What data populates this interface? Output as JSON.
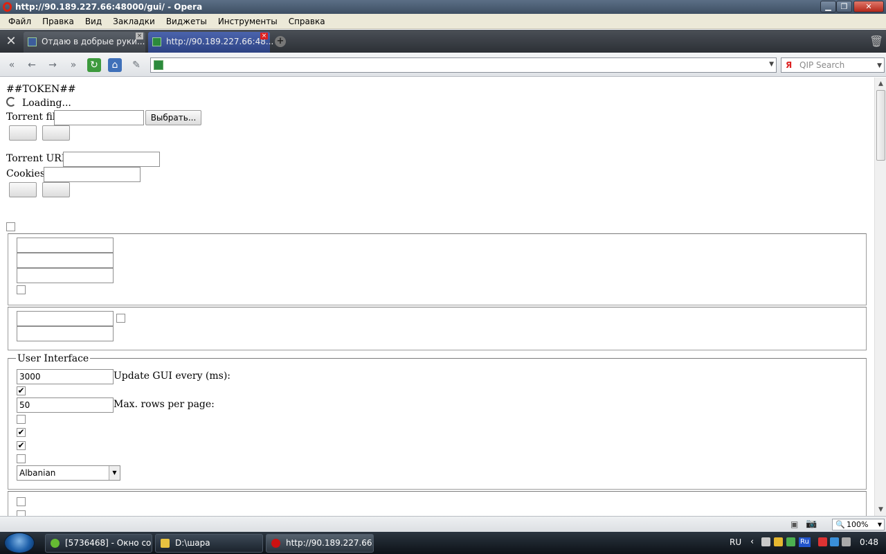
{
  "window": {
    "title": "http://90.189.227.66:48000/gui/ - Opera",
    "minimize": "▁",
    "maximize": "❐",
    "close": "✕"
  },
  "menu": [
    "Файл",
    "Правка",
    "Вид",
    "Закладки",
    "Виджеты",
    "Инструменты",
    "Справка"
  ],
  "tabs": [
    {
      "label": "Отдаю в добрые руки..."
    },
    {
      "label": "http://90.189.227.66:48..."
    }
  ],
  "search": {
    "placeholder": "QIP Search",
    "engine_glyph": "Я"
  },
  "page": {
    "token": "##TOKEN##",
    "loading": "Loading...",
    "torrent_file_label": "Torrent file:",
    "browse_button": "Выбрать...",
    "torrent_url_label": "Torrent URL:",
    "cookies_label": "Cookies:",
    "ui_legend": "User Interface",
    "update_interval": "3000",
    "update_label": "Update GUI every (ms):",
    "max_rows": "50",
    "max_rows_label": "Max. rows per page:",
    "language": "Albanian"
  },
  "status": {
    "zoom": "100%"
  },
  "taskbar": {
    "tasks": [
      "[5736468] - Окно со...",
      "D:\\шара",
      "http://90.189.227.66:..."
    ],
    "lang": "RU",
    "clock": "0:48",
    "ru_badge": "Ru"
  },
  "colors": {
    "accent_red": "#cc1111",
    "taskbar": "#1b232c",
    "tab_active": "#3b4f8f"
  }
}
